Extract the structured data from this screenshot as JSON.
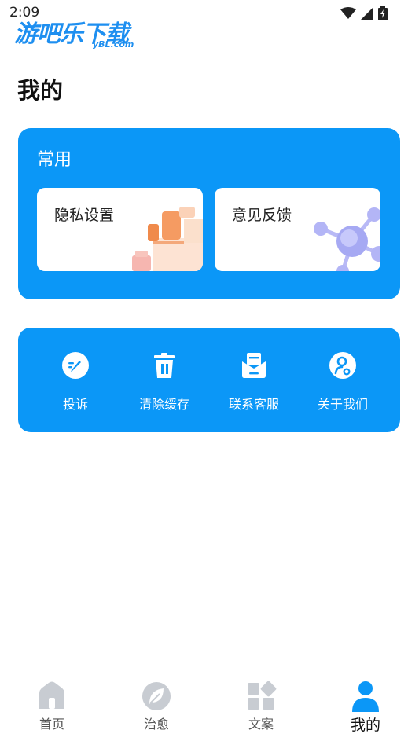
{
  "status": {
    "time": "2:09"
  },
  "watermark": {
    "main": "游吧乐下载",
    "sub": "yBL.com"
  },
  "page": {
    "title": "我的"
  },
  "common": {
    "title": "常用",
    "tiles": [
      {
        "label": "隐私设置"
      },
      {
        "label": "意见反馈"
      }
    ]
  },
  "actions": [
    {
      "label": "投诉",
      "icon": "edit-icon"
    },
    {
      "label": "清除缓存",
      "icon": "trash-icon"
    },
    {
      "label": "联系客服",
      "icon": "mail-icon"
    },
    {
      "label": "关于我们",
      "icon": "user-icon"
    }
  ],
  "tabs": [
    {
      "label": "首页",
      "icon": "home-icon",
      "active": false
    },
    {
      "label": "治愈",
      "icon": "leaf-icon",
      "active": false
    },
    {
      "label": "文案",
      "icon": "grid-icon",
      "active": false
    },
    {
      "label": "我的",
      "icon": "profile-icon",
      "active": true
    }
  ],
  "colors": {
    "accent": "#0b97f7",
    "tab_inactive": "#c8ccd2",
    "tab_active": "#0b97f7"
  }
}
